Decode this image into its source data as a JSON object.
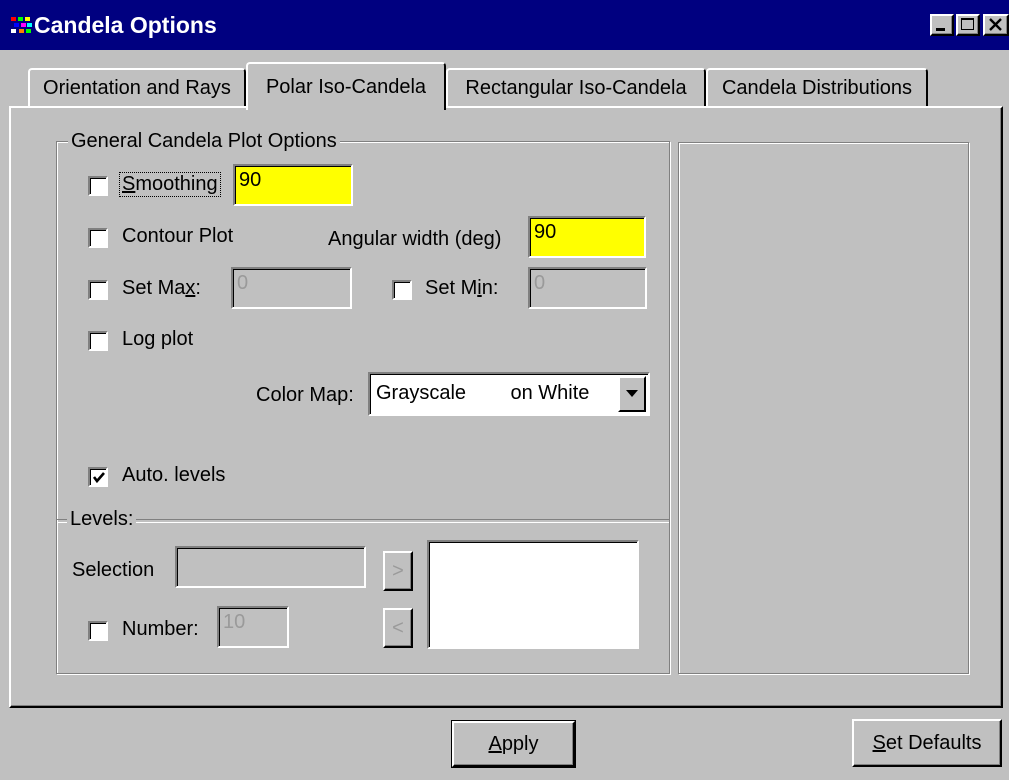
{
  "window": {
    "title": "Candela Options"
  },
  "tabs": [
    {
      "label": "Orientation and Rays",
      "active": false
    },
    {
      "label": "Polar Iso-Candela",
      "active": true
    },
    {
      "label": "Rectangular Iso-Candela",
      "active": false
    },
    {
      "label": "Candela Distributions",
      "active": false
    }
  ],
  "general": {
    "group_title": "General Candela Plot Options",
    "smoothing": {
      "label_pre": "",
      "label_ul": "S",
      "label_post": "moothing",
      "checked": false,
      "value": "90"
    },
    "contour_plot": {
      "label": "Contour Plot",
      "checked": false
    },
    "angular_width": {
      "label": "Angular width (deg)",
      "value": "90"
    },
    "set_max": {
      "label_pre": "Set Ma",
      "label_ul": "x",
      "label_post": ":",
      "checked": false,
      "value": "0"
    },
    "set_min": {
      "label_pre": "Set M",
      "label_ul": "i",
      "label_post": "n:",
      "checked": false,
      "value": "0"
    },
    "log_plot": {
      "label": "Log plot",
      "checked": false
    },
    "color_map": {
      "label": "Color Map:",
      "value": "Grayscale        on White"
    },
    "auto_levels": {
      "label": "Auto. levels",
      "checked": true
    }
  },
  "levels": {
    "group_title": "Levels:",
    "selection_label": "Selection",
    "selection_value": "",
    "number_label": "Number:",
    "number_checked": false,
    "number_value": "10",
    "add_symbol": ">",
    "remove_symbol": "<"
  },
  "footer": {
    "apply_ul": "A",
    "apply_rest": "pply",
    "defaults_ul": "S",
    "defaults_rest": "et Defaults"
  },
  "colors": {
    "titlebar": "#000080",
    "face": "#c0c0c0",
    "highlight_field": "#ffff00"
  },
  "icons": [
    "app-icon",
    "minimize-icon",
    "maximize-icon",
    "close-icon",
    "chevron-down-icon",
    "check-icon"
  ]
}
